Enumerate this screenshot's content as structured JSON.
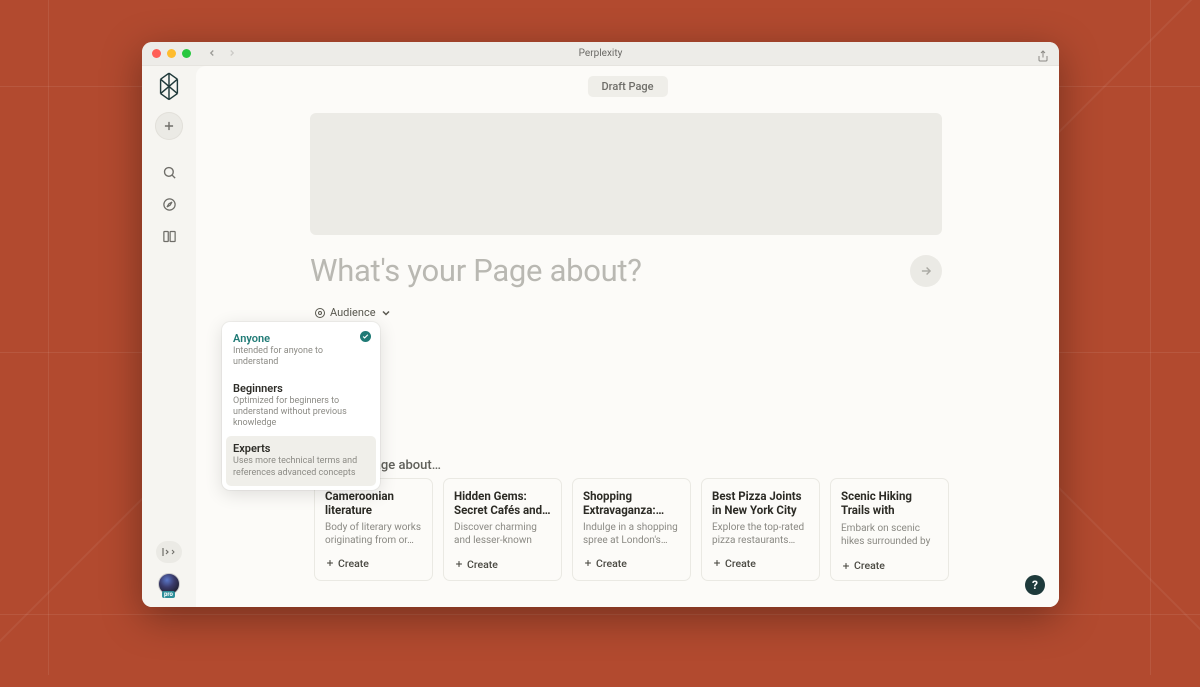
{
  "app": {
    "title": "Perplexity"
  },
  "sidebar": {
    "logo": "perplexity-logo",
    "plus": "New",
    "icons": [
      "search-icon",
      "compass-icon",
      "library-icon"
    ],
    "avatar_badge": "pro"
  },
  "header": {
    "draft_chip": "Draft Page"
  },
  "prompt": {
    "placeholder": "What's your Page about?"
  },
  "audience": {
    "trigger": "Audience",
    "options": [
      {
        "title": "Anyone",
        "desc": "Intended for anyone to understand",
        "selected": true
      },
      {
        "title": "Beginners",
        "desc": "Optimized for beginners to understand without previous knowledge",
        "selected": false
      },
      {
        "title": "Experts",
        "desc": "Uses more technical terms and references advanced concepts",
        "selected": false,
        "hover": true
      }
    ]
  },
  "suggestions": {
    "section_title": "Create a Page about…",
    "create_label": "Create",
    "cards": [
      {
        "title": "Cameroonian literature",
        "desc": "Body of literary works originating from or…"
      },
      {
        "title": "Hidden Gems: Secret Cafés and…",
        "desc": "Discover charming and lesser-known coffee…"
      },
      {
        "title": "Shopping Extravaganza:…",
        "desc": "Indulge in a shopping spree at London's…"
      },
      {
        "title": "Best Pizza Joints in New York City",
        "desc": "Explore the top-rated pizza restaurants…"
      },
      {
        "title": "Scenic Hiking Trails with Breathtaking…",
        "desc": "Embark on scenic hikes surrounded by stunnin…"
      }
    ]
  },
  "help": {
    "label": "?"
  }
}
